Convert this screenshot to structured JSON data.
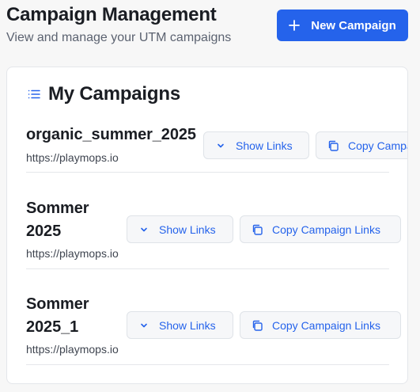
{
  "header": {
    "title": "Campaign Management",
    "subtitle": "View and manage your UTM campaigns",
    "new_button_label": "New Campaign"
  },
  "card": {
    "title": "My Campaigns"
  },
  "campaigns": [
    {
      "name": "organic_summer_2025",
      "url": "https://playmops.io",
      "show_links_label": "Show Links",
      "copy_label": "Copy Campaign Links"
    },
    {
      "name_lines": [
        "Sommer",
        "2025"
      ],
      "url": "https://playmops.io",
      "show_links_label": "Show Links",
      "copy_label": "Copy Campaign Links"
    },
    {
      "name_lines": [
        "Sommer",
        "2025_1"
      ],
      "url": "https://playmops.io",
      "show_links_label": "Show Links",
      "copy_label": "Copy Campaign Links"
    }
  ],
  "icons": {
    "new_button": "plus-icon",
    "card_title": "list-icon",
    "show_links": "chevron-down-icon",
    "copy": "copy-icon"
  },
  "colors": {
    "primary": "#2563eb",
    "background": "#f7f7f7",
    "card": "#ffffff"
  }
}
